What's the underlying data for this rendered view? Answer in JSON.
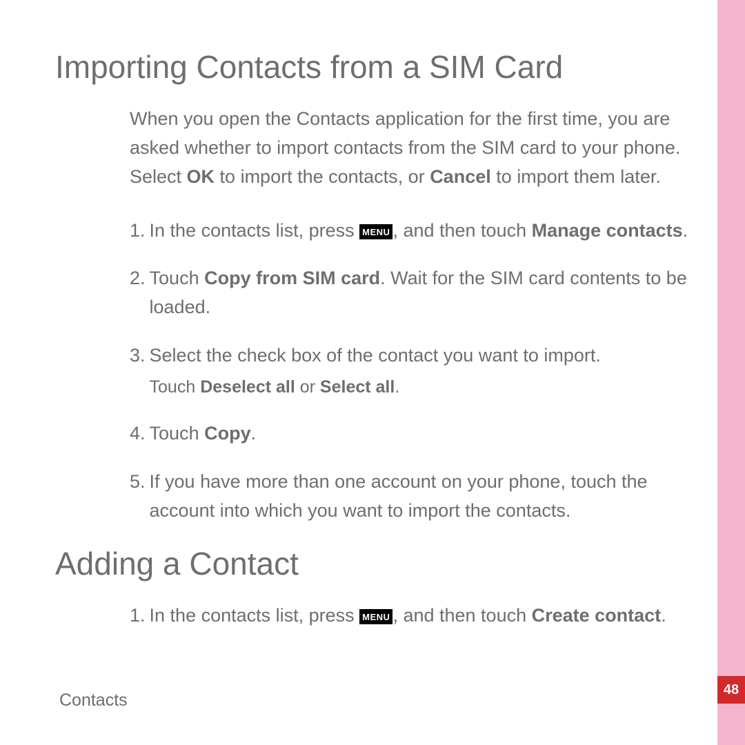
{
  "page_number": "48",
  "footer": "Contacts",
  "menu_label": "MENU",
  "section1": {
    "title": "Importing Contacts from a SIM Card",
    "intro_parts": {
      "p1": "When you open the Contacts application for the first time, you are asked whether to import contacts from the SIM card to your phone. Select ",
      "b1": "OK",
      "p2": " to import the contacts, or ",
      "b2": "Cancel",
      "p3": " to import them later."
    },
    "steps": [
      {
        "num": "1.",
        "pre": "In the contacts list, press ",
        "post": ", and then touch ",
        "bold_post": "Manage contacts",
        "tail": "."
      },
      {
        "num": "2.",
        "pre": "Touch ",
        "bold": "Copy from SIM card",
        "post": ". Wait for the SIM card contents to be loaded."
      },
      {
        "num": "3.",
        "pre": "Select the check box of the contact you want to import.",
        "sub_pre": "Touch ",
        "sub_b1": "Deselect all",
        "sub_mid": " or ",
        "sub_b2": "Select all",
        "sub_tail": "."
      },
      {
        "num": "4.",
        "pre": "Touch ",
        "bold": "Copy",
        "post": "."
      },
      {
        "num": "5.",
        "pre": "If you have more than one account on your phone, touch the account into which you want to import the contacts."
      }
    ]
  },
  "section2": {
    "title": "Adding a Contact",
    "step1": {
      "num": "1.",
      "pre": "In the contacts list, press ",
      "post": ", and then touch ",
      "bold": "Create contact",
      "tail": "."
    }
  }
}
